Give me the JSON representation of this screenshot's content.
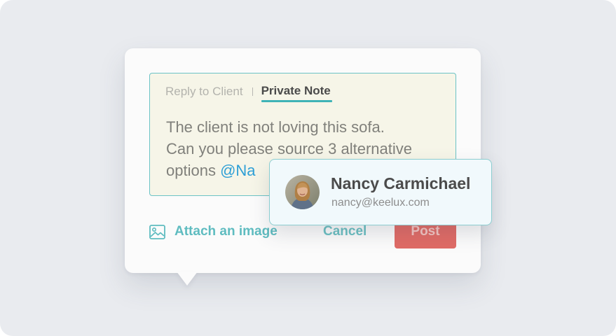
{
  "tabs": {
    "reply": "Reply to Client",
    "private": "Private Note"
  },
  "message": {
    "line1": "The client is not loving this sofa.",
    "line2": "Can you please source 3 alternative",
    "line3_prefix": "options ",
    "mention": "@Na"
  },
  "actions": {
    "attach": "Attach an image",
    "cancel": "Cancel",
    "post": "Post"
  },
  "suggestion": {
    "name": "Nancy Carmichael",
    "email": "nancy@keelux.com"
  },
  "colors": {
    "background": "#e9ebef",
    "accent": "#3fb3b6",
    "mention": "#2e9fd6",
    "post": "#e06b66"
  },
  "icons": {
    "attach": "image-icon"
  }
}
